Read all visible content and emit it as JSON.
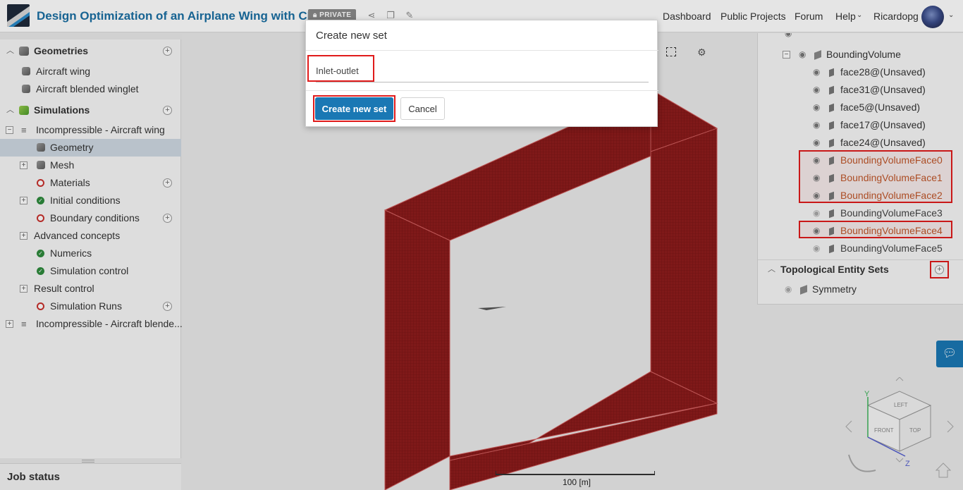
{
  "header": {
    "title": "Design Optimization of an Airplane Wing with CFD",
    "badge": "PRIVATE",
    "nav": [
      "Dashboard",
      "Public Projects",
      "Forum",
      "Help",
      "Ricardopg"
    ]
  },
  "left_tree": {
    "geometries_label": "Geometries",
    "geometries": [
      "Aircraft wing",
      "Aircraft blended winglet"
    ],
    "simulations_label": "Simulations",
    "sim1": "Incompressible - Aircraft wing",
    "sim1_children": {
      "geometry": "Geometry",
      "mesh": "Mesh",
      "materials": "Materials",
      "initial": "Initial conditions",
      "boundary": "Boundary conditions",
      "advanced": "Advanced concepts",
      "numerics": "Numerics",
      "control": "Simulation control",
      "result": "Result control",
      "runs": "Simulation Runs"
    },
    "sim2": "Incompressible - Aircraft blende..."
  },
  "job_status": "Job status",
  "viewport": {
    "scale_label": "100 [m]",
    "mesh_color": "#8b1a1a"
  },
  "right_tree": {
    "bounding_volume": "BoundingVolume",
    "faces": [
      "face28@(Unsaved)",
      "face31@(Unsaved)",
      "face5@(Unsaved)",
      "face17@(Unsaved)",
      "face24@(Unsaved)",
      "BoundingVolumeFace0",
      "BoundingVolumeFace1",
      "BoundingVolumeFace2",
      "BoundingVolumeFace3",
      "BoundingVolumeFace4",
      "BoundingVolumeFace5"
    ],
    "topo_header": "Topological Entity Sets",
    "topo_items": [
      "Symmetry"
    ]
  },
  "modal": {
    "title": "Create new set",
    "input_value": "Inlet-outlet",
    "create_label": "Create new set",
    "cancel_label": "Cancel"
  },
  "nav_cube": {
    "labels": [
      "FRONT",
      "TOP",
      "LEFT"
    ],
    "axes": [
      "Y",
      "Z"
    ]
  },
  "colors": {
    "accent": "#1a78b4",
    "highlight": "#e01b1b",
    "selected_face": "#c0562a"
  }
}
